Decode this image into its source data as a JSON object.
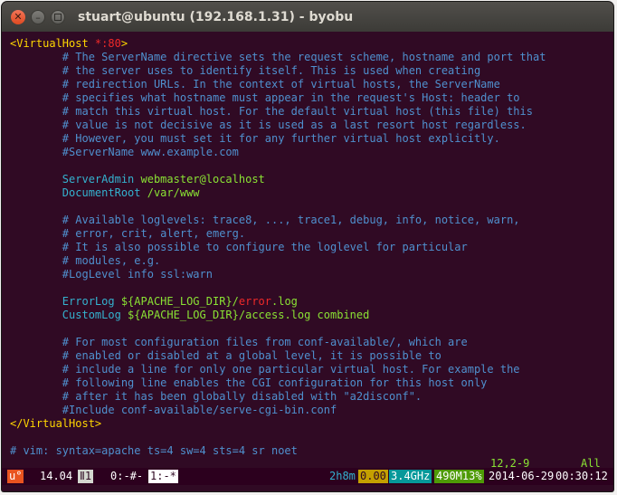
{
  "window": {
    "title": "stuart@ubuntu (192.168.1.31) - byobu"
  },
  "editor": {
    "lines": [
      [
        {
          "t": "<VirtualHost ",
          "c": "tag"
        },
        {
          "t": "*:80",
          "c": "red"
        },
        {
          "t": ">",
          "c": "tag"
        }
      ],
      [
        {
          "t": "        # The ServerName directive sets the request scheme, hostname and port that",
          "c": "comment"
        }
      ],
      [
        {
          "t": "        # the server uses to identify itself. This is used when creating",
          "c": "comment"
        }
      ],
      [
        {
          "t": "        # redirection URLs. In the context of virtual hosts, the ServerName",
          "c": "comment"
        }
      ],
      [
        {
          "t": "        # specifies what hostname must appear in the request's Host: header to",
          "c": "comment"
        }
      ],
      [
        {
          "t": "        # match this virtual host. For the default virtual host (this file) this",
          "c": "comment"
        }
      ],
      [
        {
          "t": "        # value is not decisive as it is used as a last resort host regardless.",
          "c": "comment"
        }
      ],
      [
        {
          "t": "        # However, you must set it for any further virtual host explicitly.",
          "c": "comment"
        }
      ],
      [
        {
          "t": "        #ServerName www.example.com",
          "c": "comment"
        }
      ],
      [],
      [
        {
          "t": "        ServerAdmin ",
          "c": "teal"
        },
        {
          "t": "webmaster@localhost",
          "c": "green"
        }
      ],
      [
        {
          "t": "        DocumentRoot ",
          "c": "teal"
        },
        {
          "t": "/var/www",
          "c": "green"
        }
      ],
      [],
      [
        {
          "t": "        # Available loglevels: trace8, ..., trace1, debug, info, notice, warn,",
          "c": "comment"
        }
      ],
      [
        {
          "t": "        # error, crit, alert, emerg.",
          "c": "comment"
        }
      ],
      [
        {
          "t": "        # It is also possible to configure the loglevel for particular",
          "c": "comment"
        }
      ],
      [
        {
          "t": "        # modules, e.g.",
          "c": "comment"
        }
      ],
      [
        {
          "t": "        #LogLevel info ssl:warn",
          "c": "comment"
        }
      ],
      [],
      [
        {
          "t": "        ErrorLog ",
          "c": "teal"
        },
        {
          "t": "${APACHE_LOG_DIR}/",
          "c": "green"
        },
        {
          "t": "error",
          "c": "red"
        },
        {
          "t": ".log",
          "c": "green"
        }
      ],
      [
        {
          "t": "        CustomLog ",
          "c": "teal"
        },
        {
          "t": "${APACHE_LOG_DIR}/access.log combined",
          "c": "green"
        }
      ],
      [],
      [
        {
          "t": "        # For most configuration files from conf-available/, which are",
          "c": "comment"
        }
      ],
      [
        {
          "t": "        # enabled or disabled at a global level, it is possible to",
          "c": "comment"
        }
      ],
      [
        {
          "t": "        # include a line for only one particular virtual host. For example the",
          "c": "comment"
        }
      ],
      [
        {
          "t": "        # following line enables the CGI configuration for this host only",
          "c": "comment"
        }
      ],
      [
        {
          "t": "        # after it has been globally disabled with \"a2disconf\".",
          "c": "comment"
        }
      ],
      [
        {
          "t": "        #Include conf-available/serve-cgi-bin.conf",
          "c": "comment"
        }
      ],
      [
        {
          "t": "</VirtualHost>",
          "c": "tag"
        }
      ],
      [],
      [
        {
          "t": "# vim: syntax=apache ts=4 sw=4 sts=4 sr noet",
          "c": "comment"
        }
      ]
    ],
    "ruler": {
      "position": "12,2-9",
      "scroll": "All"
    }
  },
  "statusbar": {
    "logo": "u°",
    "release": "14.04",
    "tmux_icon": "Ⅱ",
    "session_count": "1",
    "windows": [
      "0:-#-",
      "1:-*"
    ],
    "uptime": "2h8m",
    "load": "0.00",
    "cpu_freq": "3.4GHz",
    "memory": "490M13%",
    "date": "2014-06-29",
    "time": "00:30:12"
  },
  "colors": {
    "comment": "#4f90ce",
    "tag": "#ffd700",
    "red": "#ef2929",
    "green": "#8ae234",
    "teal": "#34b2cf",
    "status_bg": "#2c001e",
    "logo_bg": "#e95420",
    "uptime_bg": "#4e9a06",
    "load_bg": "#c4a000",
    "cpu_bg": "#06989a",
    "mem_bg": "#4e9a06"
  }
}
